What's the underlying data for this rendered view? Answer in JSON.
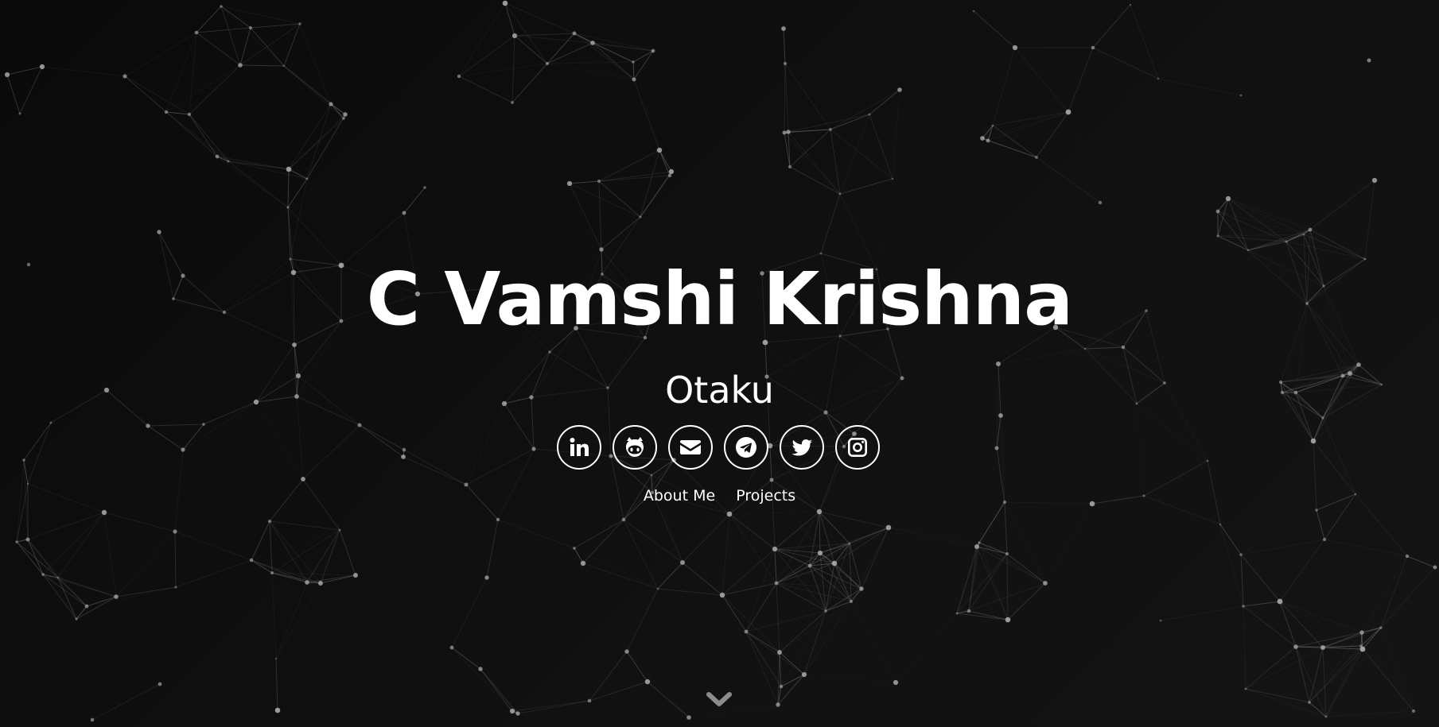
{
  "hero": {
    "name": "C Vamshi Krishna",
    "tagline": "Otaku"
  },
  "socials": [
    {
      "name": "linkedin-icon"
    },
    {
      "name": "github-icon"
    },
    {
      "name": "email-icon"
    },
    {
      "name": "telegram-icon"
    },
    {
      "name": "twitter-icon"
    },
    {
      "name": "instagram-icon"
    }
  ],
  "nav": {
    "about_label": "About Me",
    "projects_label": "Projects"
  },
  "scroll": {
    "icon": "chevron-down-icon"
  },
  "colors": {
    "background": "#0d0d0d",
    "foreground": "#ffffff",
    "network_line": "#8a8a8a",
    "network_node": "#b5b5b5"
  }
}
